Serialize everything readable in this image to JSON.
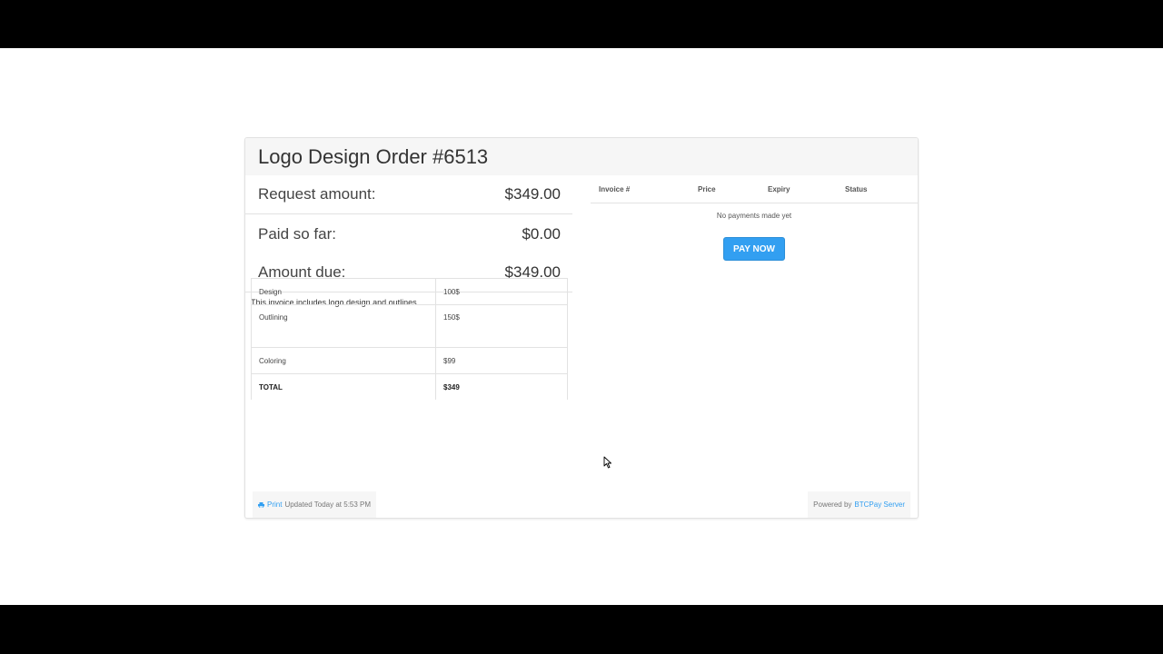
{
  "header": {
    "title": "Logo Design Order #6513"
  },
  "amounts": {
    "request_label": "Request amount:",
    "request_value": "$349.00",
    "paid_label": "Paid so far:",
    "paid_value": "$0.00",
    "due_label": "Amount due:",
    "due_value": "$349.00"
  },
  "description": "This invoice includes logo design and outlines.",
  "items": [
    {
      "name": "Design",
      "price": "100$"
    },
    {
      "name": "Outlining",
      "price": "150$"
    },
    {
      "name": "Coloring",
      "price": "$99"
    },
    {
      "name": "TOTAL",
      "price": "$349"
    }
  ],
  "payments": {
    "columns": [
      "Invoice #",
      "Price",
      "Expiry",
      "Status"
    ],
    "empty_text": "No payments made yet",
    "pay_button": "PAY NOW"
  },
  "footer": {
    "print_label": "Print",
    "updated_text": "Updated Today at 5:53 PM",
    "powered_prefix": "Powered by",
    "powered_link": "BTCPay Server"
  },
  "colors": {
    "accent": "#329ff1",
    "header_bg": "#f6f6f6"
  }
}
